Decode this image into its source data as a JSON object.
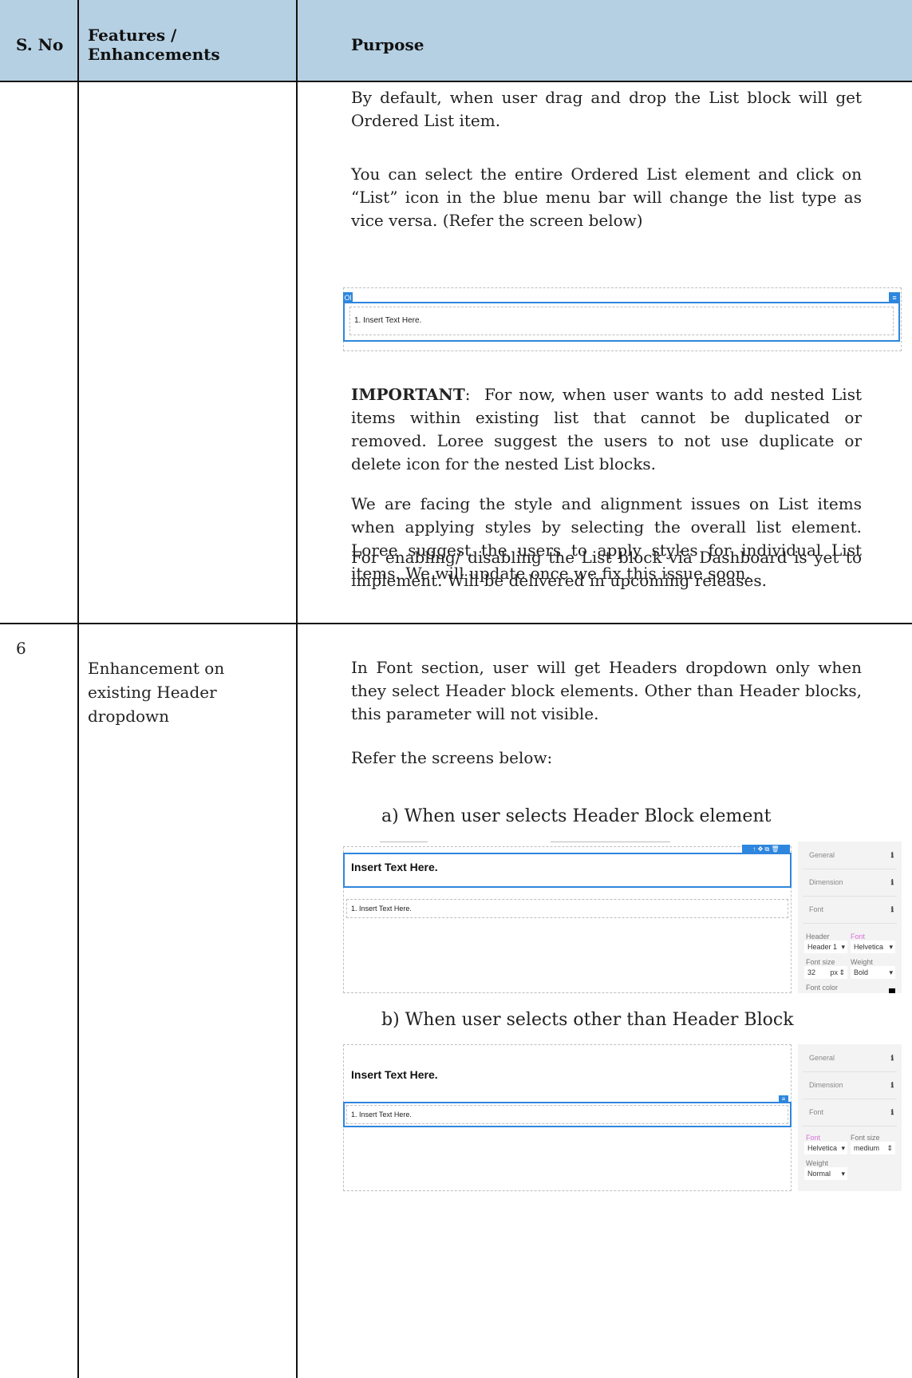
{
  "header": {
    "col1": "S. No",
    "col2": "Features / Enhancements",
    "col3": "Purpose"
  },
  "row_list": {
    "paragraphs": [
      "By default, when user drag and drop the List block will get Ordered List item.",
      "You can select the entire Ordered List element and click on “List” icon in the blue menu bar will change the list type as vice versa. (Refer the screen below)",
      "For now, when user wants to add nested List items within existing list that cannot be duplicated or removed. Loree suggest the users to not use duplicate or delete icon for the nested List blocks.",
      "We are facing the style and alignment issues on List items when applying styles by selecting the overall list element. Loree suggest the users to apply styles for individual List items. We will update once we fix this issue soon.",
      "For enabling/ disabling the List block via Dashboard is yet to implement. Will be delivered in upcoming releases."
    ],
    "important_label": "IMPORTANT",
    "screenshot": {
      "tag_left": "Ol",
      "list_item": "1.  Insert Text Here."
    }
  },
  "row6": {
    "sno": "6",
    "feature": "Enhancement on existing Header dropdown",
    "para1": "In Font section, user will get Headers dropdown only when they select Header block elements. Other than Header blocks, this parameter will not visible.",
    "para2": "Refer the screens below:",
    "item_a": "a)   When user selects Header Block element",
    "item_b": "b)   When user selects other than Header Block",
    "shot_a": {
      "heading": "Insert Text Here.",
      "list_item": "1.  Insert Text Here.",
      "panel": {
        "general": "General",
        "dimension": "Dimension",
        "font": "Font",
        "header_label": "Header",
        "header_value": "Header 1",
        "font_label": "Font",
        "font_value": "Helvetica",
        "size_label": "Font size",
        "size_value": "32",
        "size_unit": "px",
        "weight_label": "Weight",
        "weight_value": "Bold",
        "color_label": "Font color"
      }
    },
    "shot_b": {
      "heading": "Insert Text Here.",
      "list_item": "1.  Insert Text Here.",
      "panel": {
        "general": "General",
        "dimension": "Dimension",
        "font": "Font",
        "font_label": "Font",
        "font_value": "Helvetica",
        "size_label": "Font size",
        "size_value": "medium",
        "weight_label": "Weight",
        "weight_value": "Normal"
      }
    }
  }
}
